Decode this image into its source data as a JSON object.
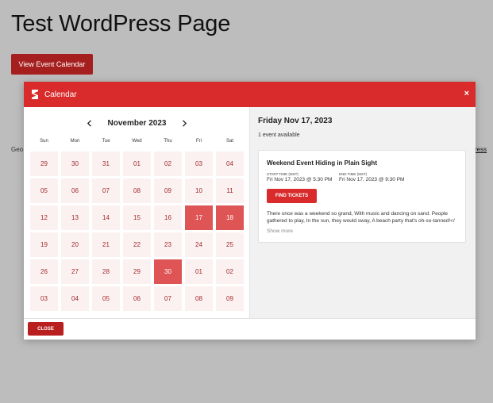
{
  "page": {
    "title": "Test WordPress Page",
    "view_button": "View Event Calendar",
    "bg_text_left": "Geo",
    "bg_text_right": "ress"
  },
  "modal": {
    "title": "Calendar",
    "close_icon": "×",
    "accent_color": "#d92b2b",
    "calendar": {
      "month_label": "November 2023",
      "weekdays": [
        "Sun",
        "Mon",
        "Tue",
        "Wed",
        "Thu",
        "Fri",
        "Sat"
      ],
      "days": [
        {
          "n": "29",
          "active": false
        },
        {
          "n": "30",
          "active": false
        },
        {
          "n": "31",
          "active": false
        },
        {
          "n": "01",
          "active": false
        },
        {
          "n": "02",
          "active": false
        },
        {
          "n": "03",
          "active": false
        },
        {
          "n": "04",
          "active": false
        },
        {
          "n": "05",
          "active": false
        },
        {
          "n": "06",
          "active": false
        },
        {
          "n": "07",
          "active": false
        },
        {
          "n": "08",
          "active": false
        },
        {
          "n": "09",
          "active": false
        },
        {
          "n": "10",
          "active": false
        },
        {
          "n": "11",
          "active": false
        },
        {
          "n": "12",
          "active": false
        },
        {
          "n": "13",
          "active": false
        },
        {
          "n": "14",
          "active": false
        },
        {
          "n": "15",
          "active": false
        },
        {
          "n": "16",
          "active": false
        },
        {
          "n": "17",
          "active": true
        },
        {
          "n": "18",
          "active": true
        },
        {
          "n": "19",
          "active": false
        },
        {
          "n": "20",
          "active": false
        },
        {
          "n": "21",
          "active": false
        },
        {
          "n": "22",
          "active": false
        },
        {
          "n": "23",
          "active": false
        },
        {
          "n": "24",
          "active": false
        },
        {
          "n": "25",
          "active": false
        },
        {
          "n": "26",
          "active": false
        },
        {
          "n": "27",
          "active": false
        },
        {
          "n": "28",
          "active": false
        },
        {
          "n": "29",
          "active": false
        },
        {
          "n": "30",
          "active": true
        },
        {
          "n": "01",
          "active": false
        },
        {
          "n": "02",
          "active": false
        },
        {
          "n": "03",
          "active": false
        },
        {
          "n": "04",
          "active": false
        },
        {
          "n": "05",
          "active": false
        },
        {
          "n": "06",
          "active": false
        },
        {
          "n": "07",
          "active": false
        },
        {
          "n": "08",
          "active": false
        },
        {
          "n": "09",
          "active": false
        }
      ]
    },
    "detail": {
      "date_heading": "Friday Nov 17, 2023",
      "event_count": "1 event available",
      "event": {
        "title": "Weekend Event Hiding in Plain Sight",
        "start_label": "START TIME (MST)",
        "start_value": "Fri Nov 17, 2023 @ 5:30 PM",
        "end_label": "END TIME (MST)",
        "end_value": "Fri Nov 17, 2023 @ 9:30 PM",
        "find_tickets": "FIND TICKETS",
        "description": "There once was a weekend so grand, With music and dancing on sand. People gathered to play, In the sun, they would sway, A beach party that's oh-so-tanned!</",
        "show_more": "Show more"
      }
    },
    "footer": {
      "close_button": "CLOSE"
    }
  }
}
